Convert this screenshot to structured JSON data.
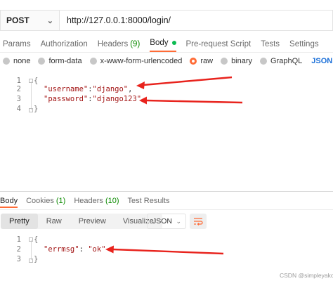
{
  "request": {
    "method": "POST",
    "url": "http://127.0.0.1:8000/login/"
  },
  "request_tabs": [
    {
      "label": "Params"
    },
    {
      "label": "Authorization"
    },
    {
      "label": "Headers",
      "count": "(9)"
    },
    {
      "label": "Body"
    },
    {
      "label": "Pre-request Script"
    },
    {
      "label": "Tests"
    },
    {
      "label": "Settings"
    }
  ],
  "body_types": {
    "options": [
      "none",
      "form-data",
      "x-www-form-urlencoded",
      "raw",
      "binary",
      "GraphQL"
    ],
    "selected": "raw",
    "format": "JSON"
  },
  "request_body": {
    "line_numbers": [
      "1",
      "2",
      "3",
      "4"
    ],
    "open_brace": "{",
    "close_brace": "}",
    "username_key": "\"username\"",
    "username_value": "\"django\"",
    "password_key": "\"password\"",
    "password_value": "\"django123\"",
    "colon": ":",
    "comma": ","
  },
  "response_tabs": [
    {
      "label": "Body"
    },
    {
      "label": "Cookies",
      "count": "(1)"
    },
    {
      "label": "Headers",
      "count": "(10)"
    },
    {
      "label": "Test Results"
    }
  ],
  "response_view": {
    "modes": [
      "Pretty",
      "Raw",
      "Preview",
      "Visualize"
    ],
    "active": "Pretty",
    "format": "JSON"
  },
  "response_body": {
    "line_numbers": [
      "1",
      "2",
      "3"
    ],
    "open_brace": "{",
    "close_brace": "}",
    "errmsg_key": "\"errmsg\"",
    "errmsg_value": "\"ok\"",
    "colon": ": "
  },
  "watermark": "CSDN @simpleyako",
  "colors": {
    "accent": "#ff6c37",
    "count": "#0b8a00",
    "body_dot": "#0cbb52",
    "json_selector": "#1a6fd8",
    "code_string": "#a31515",
    "annotation_arrow": "#e8231d"
  }
}
